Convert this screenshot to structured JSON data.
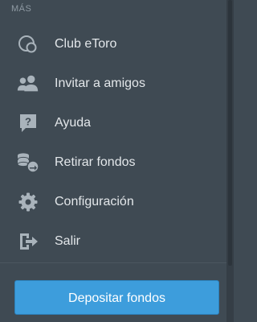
{
  "section": {
    "label": "MÁS"
  },
  "menu": {
    "items": [
      {
        "label": "Club eToro",
        "icon": "club-icon"
      },
      {
        "label": "Invitar a amigos",
        "icon": "invite-friends-icon"
      },
      {
        "label": "Ayuda",
        "icon": "help-icon"
      },
      {
        "label": "Retirar fondos",
        "icon": "withdraw-funds-icon"
      },
      {
        "label": "Configuración",
        "icon": "gear-icon"
      },
      {
        "label": "Salir",
        "icon": "logout-icon"
      }
    ]
  },
  "deposit": {
    "label": "Depositar fondos"
  },
  "colors": {
    "background": "#3f4a53",
    "icon": "#a9b3bb",
    "text": "#e3e7ea",
    "button": "#3d9ddc"
  }
}
